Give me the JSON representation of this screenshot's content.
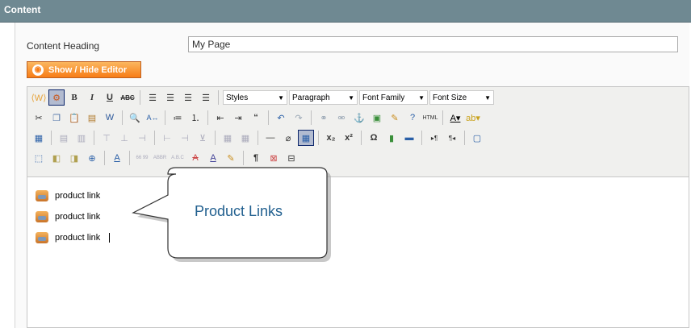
{
  "section": {
    "title": "Content"
  },
  "form": {
    "heading_label": "Content Heading",
    "heading_value": "My Page",
    "toggle_editor_label": "Show / Hide Editor"
  },
  "toolbar": {
    "styles_select": "Styles",
    "format_select": "Paragraph",
    "font_family_select": "Font Family",
    "font_size_select": "Font Size"
  },
  "content": {
    "items": [
      "product link",
      "product link",
      "product link"
    ]
  },
  "callout": {
    "text": "Product Links"
  }
}
